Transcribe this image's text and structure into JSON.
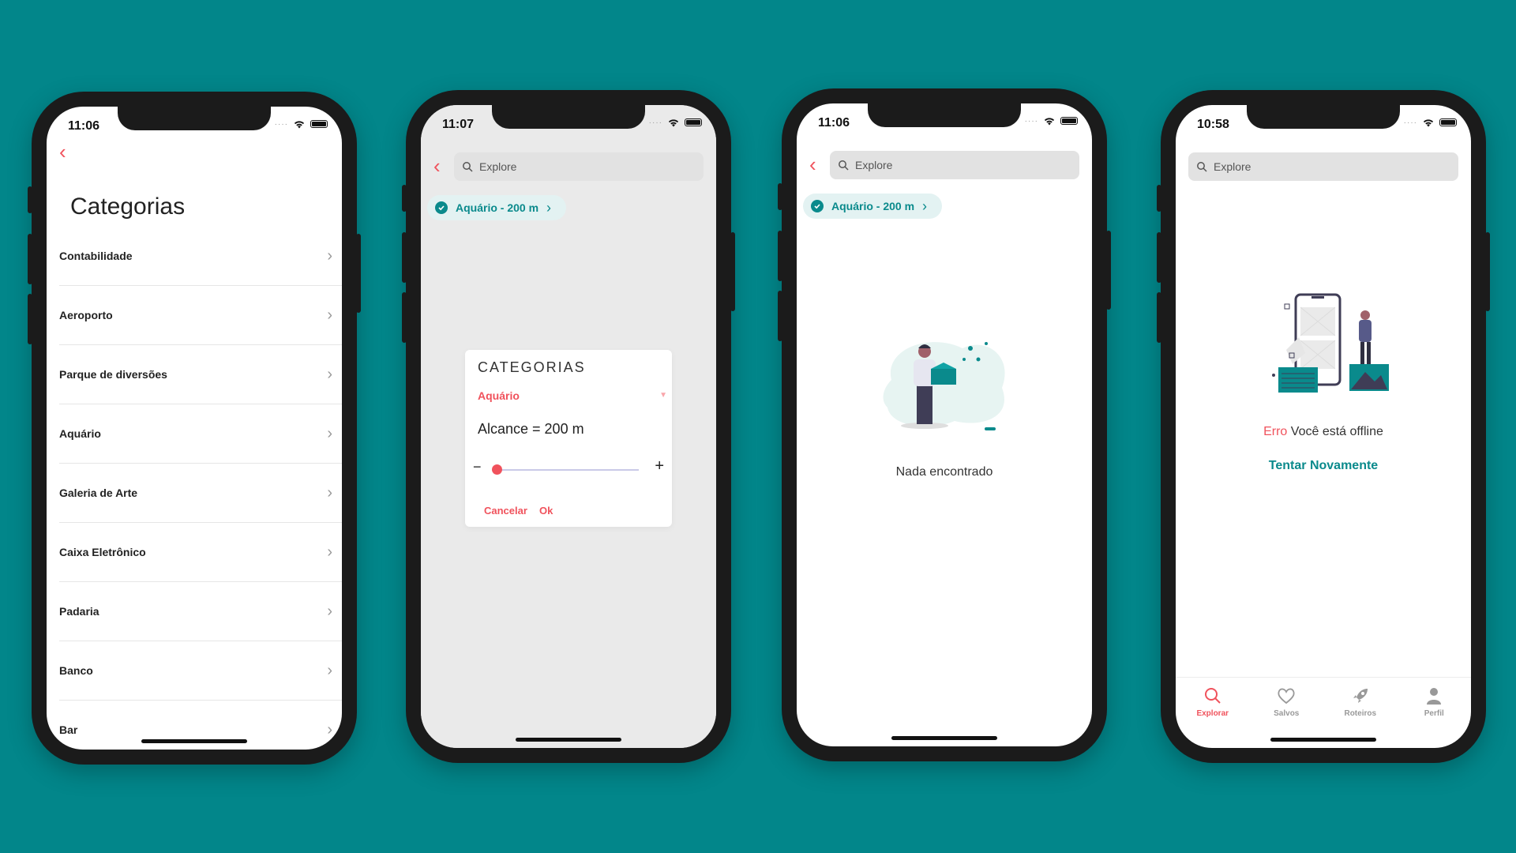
{
  "colors": {
    "background": "#02868a",
    "accent": "#f0525c",
    "teal": "#0a8a8c"
  },
  "phone1": {
    "time": "11:06",
    "title": "Categorias",
    "categories": [
      "Contabilidade",
      "Aeroporto",
      "Parque de diversões",
      "Aquário",
      "Galeria de Arte",
      "Caixa Eletrônico",
      "Padaria",
      "Banco",
      "Bar"
    ]
  },
  "phone2": {
    "time": "11:07",
    "search_placeholder": "Explore",
    "chip_label": "Aquário - 200 m",
    "modal": {
      "title": "CATEGORIAS",
      "selected": "Aquário",
      "range_label": "Alcance = 200 m",
      "minus": "−",
      "plus": "+",
      "slider_fraction": 0.02,
      "cancel": "Cancelar",
      "ok": "Ok"
    }
  },
  "phone3": {
    "time": "11:06",
    "search_placeholder": "Explore",
    "chip_label": "Aquário - 200 m",
    "empty_message": "Nada encontrado"
  },
  "phone4": {
    "time": "10:58",
    "search_placeholder": "Explore",
    "error_prefix": "Erro",
    "error_message": "Você está offline",
    "retry": "Tentar Novamente",
    "tabs": [
      {
        "label": "Explorar",
        "icon": "search-icon",
        "active": true
      },
      {
        "label": "Salvos",
        "icon": "heart-icon",
        "active": false
      },
      {
        "label": "Roteiros",
        "icon": "rocket-icon",
        "active": false
      },
      {
        "label": "Perfil",
        "icon": "user-icon",
        "active": false
      }
    ]
  }
}
